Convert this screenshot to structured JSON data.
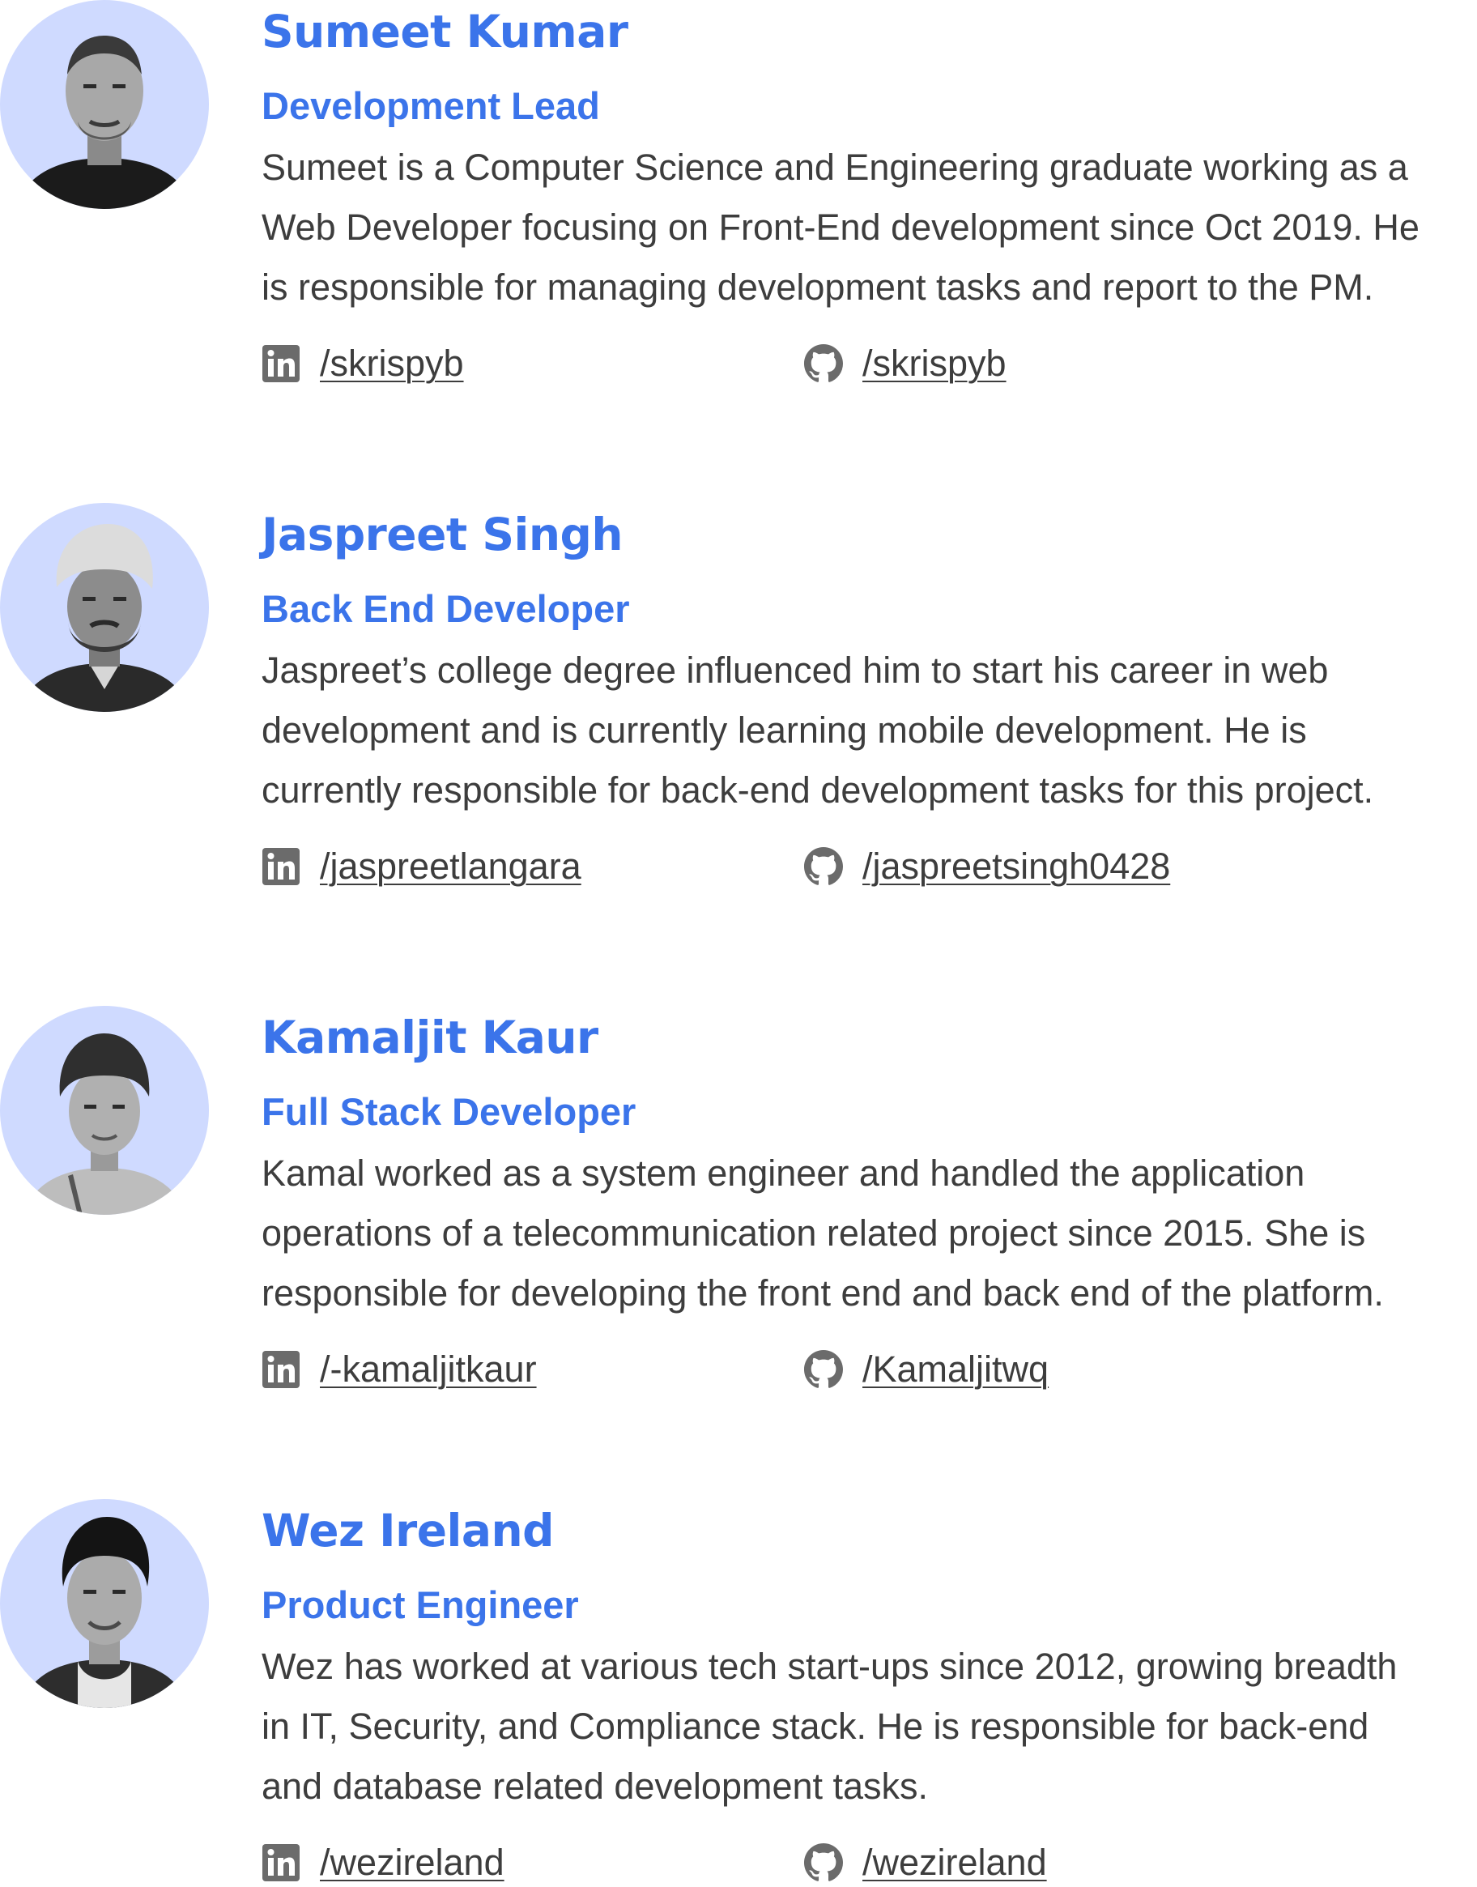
{
  "accent_color": "#3b74ea",
  "avatar_background": "#cfdaff",
  "members": [
    {
      "name": "Sumeet Kumar",
      "role": "Development Lead",
      "photo": "portrait-photo",
      "bio_lines": [
        "Sumeet is a Computer Science and Engineering graduate working as a",
        "Web Developer focusing on Front-End development since Oct 2019. He",
        "is responsible for managing development tasks and report to the PM."
      ],
      "linkedin": {
        "icon": "linkedin-icon",
        "handle": "/skrispyb"
      },
      "github": {
        "icon": "github-icon",
        "handle": "/skrispyb"
      }
    },
    {
      "name": "Jaspreet Singh",
      "role": "Back End Developer",
      "photo": "portrait-photo",
      "bio_lines": [
        "Jaspreet’s college degree influenced him to start his career in web",
        "development and is currently learning mobile development. He is",
        "currently responsible for back-end development tasks for this project."
      ],
      "linkedin": {
        "icon": "linkedin-icon",
        "handle": "/jaspreetlangara"
      },
      "github": {
        "icon": "github-icon",
        "handle": "/jaspreetsingh0428"
      }
    },
    {
      "name": "Kamaljit Kaur",
      "role": "Full Stack Developer",
      "photo": "portrait-photo",
      "bio_lines": [
        "Kamal worked as a system engineer and handled the application",
        "operations of a telecommunication related project since 2015. She is",
        "responsible for developing the front end and back end of the platform."
      ],
      "linkedin": {
        "icon": "linkedin-icon",
        "handle": "/-kamaljitkaur"
      },
      "github": {
        "icon": "github-icon",
        "handle": "/Kamaljitwq"
      }
    },
    {
      "name": "Wez Ireland",
      "role": "Product Engineer",
      "photo": "portrait-photo",
      "bio_lines": [
        "Wez has worked at various tech start-ups since 2012, growing breadth",
        "in IT,  Security, and Compliance stack. He is responsible for back-end",
        "and database related development tasks."
      ],
      "linkedin": {
        "icon": "linkedin-icon",
        "handle": "/wezireland"
      },
      "github": {
        "icon": "github-icon",
        "handle": "/wezireland"
      }
    }
  ]
}
